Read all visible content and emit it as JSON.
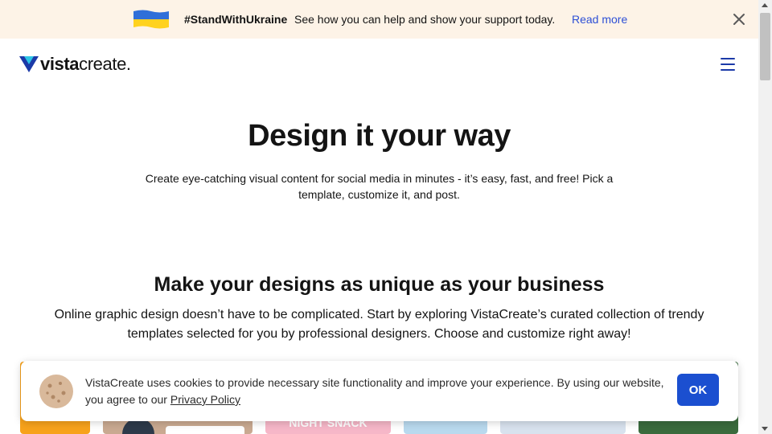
{
  "banner": {
    "hashtag": "#StandWithUkraine",
    "message": "See how you can help and show your support today.",
    "link_label": "Read more",
    "flag_colors": [
      "#2f6fd9",
      "#ffd21f"
    ]
  },
  "header": {
    "logo_bold": "vista",
    "logo_regular": "create",
    "logo_dot": ".",
    "brand_color": "#1b3aa8"
  },
  "hero": {
    "title": "Design it your way",
    "subtitle": "Create eye-catching visual content for social media in minutes - it’s easy, fast, and free! Pick a template, customize it, and post."
  },
  "section": {
    "title": "Make your designs as unique as your business",
    "subtitle": "Online graphic design doesn’t have to be complicated. Start by exploring VistaCreate’s curated collection of trendy templates selected for you by professional designers. Choose and customize right away!"
  },
  "templates": [
    {
      "caption": "",
      "color": "#f7a21b"
    },
    {
      "caption": "",
      "color": "#c9a991"
    },
    {
      "caption": "NIGHT SNACK",
      "color": "#f6b7c8"
    },
    {
      "caption": "",
      "color": "#b9d9ee"
    },
    {
      "caption": "",
      "color": "#d8e2ee"
    },
    {
      "caption": "",
      "color": "#3a6b3d"
    }
  ],
  "cookie": {
    "text": "VistaCreate uses cookies to provide necessary site functionality and improve your experience. By using our website, you agree to our ",
    "link_label": "Privacy Policy",
    "ok_label": "OK"
  },
  "colors": {
    "accent": "#1b4fd0",
    "link": "#2d4fd6",
    "banner_bg": "#fdf3e7"
  }
}
